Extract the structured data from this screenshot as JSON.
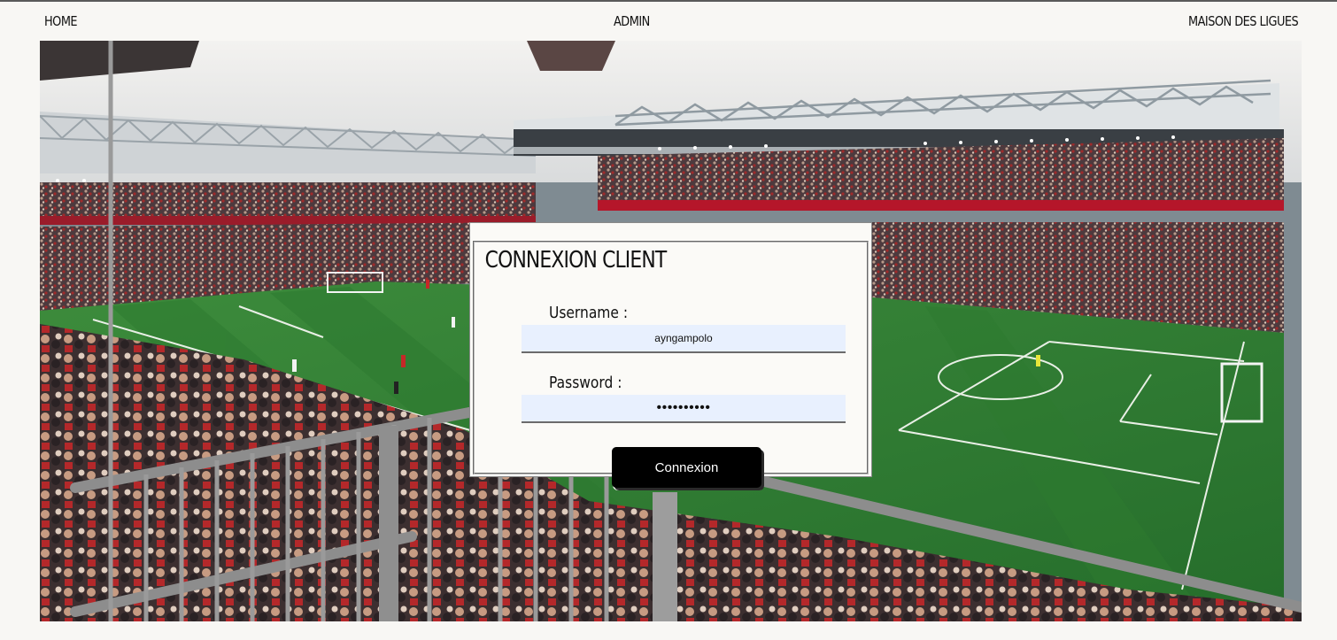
{
  "nav": {
    "home": "HOME",
    "admin": "ADMIN",
    "brand": "MAISON DES LIGUES"
  },
  "login": {
    "title": "CONNEXION CLIENT",
    "username_label": "Username :",
    "username_value": "ayngampolo",
    "password_label": "Password :",
    "password_value": "••••••••••",
    "submit_label": "Connexion"
  },
  "colors": {
    "page_background": "#f8f7f4",
    "input_background": "#e8f0fe",
    "button_background": "#000000",
    "pitch_green": "#2f7a33"
  },
  "hero_image": "football-stadium-photo"
}
